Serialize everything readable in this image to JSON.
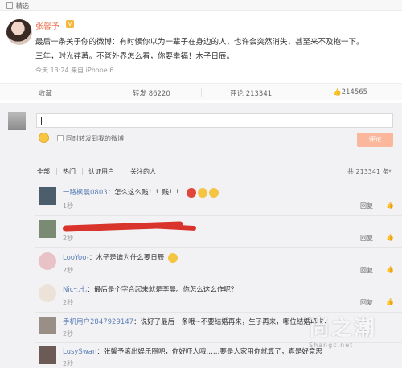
{
  "topbar": {
    "label": "精选"
  },
  "post": {
    "author": "张馨予",
    "vip_badge": "V",
    "text_line1": "最后一条关于你的微博：有时候你以为一辈子在身边的人，也许会突然消失，甚至来不及抱一下。",
    "text_line2": "三年，时光荏苒。不管外界怎么看，你要幸福！木子日辰。",
    "meta": "今天 13:24 来自 iPhone 6"
  },
  "actions": {
    "favorite": "收藏",
    "repost": "转发 86220",
    "comment": "评论 213341",
    "like": "214565"
  },
  "composer": {
    "checkbox_label": "同时转发到我的微博",
    "submit": "评论"
  },
  "filters": {
    "tabs": [
      "全部",
      "热门",
      "认证用户",
      "关注的人"
    ],
    "count": "共 213341 条"
  },
  "comments": [
    {
      "user": "一路枫晨0803",
      "text": "：怎么这么贱！！贱！！",
      "time": "1秒",
      "reply": "回复"
    },
    {
      "user": "",
      "text": "",
      "time": "2秒",
      "reply": "回复"
    },
    {
      "user": "LooYoo-",
      "text": "：木子是谁为什么要日辰",
      "time": "2秒",
      "reply": "回复"
    },
    {
      "user": "Nic七七",
      "text": "：最后是个字合起来就是李晨。你怎么这么作呢？",
      "time": "2秒",
      "reply": "回复"
    },
    {
      "user": "手机用户2847929147",
      "text": "：说好了最后一条哦~不要结婚再来，生子再来，哪位结婚再来，亲婚再来，又要再来咯~",
      "time": "2秒",
      "reply": "回复"
    },
    {
      "user": "LusySwan",
      "text": "：张馨予滚出娱乐圈吧，你好吓人哦……要是人家用你就算了，真是好意思",
      "time": "2秒",
      "reply": "回复"
    }
  ],
  "watermark": {
    "main": "尚之潮",
    "sub": "Shangc.net"
  },
  "colors": {
    "accent": "#eb7350",
    "link": "#5b7fb5",
    "panel": "#f2f2f5",
    "button": "#fab79b"
  }
}
